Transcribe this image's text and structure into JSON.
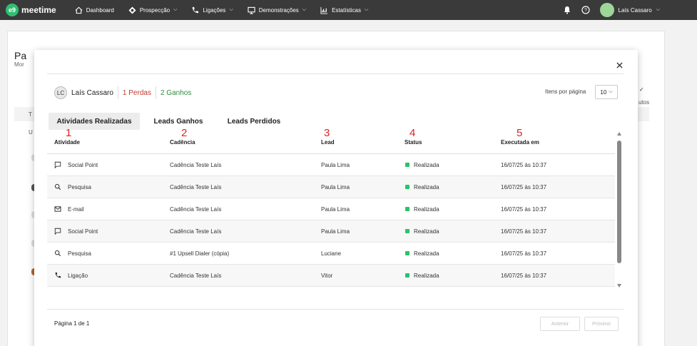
{
  "topbar": {
    "logo_mark": "e9",
    "logo_text": "meetime",
    "nav": [
      {
        "label": "Dashboard",
        "icon": "home-icon"
      },
      {
        "label": "Prospecção",
        "icon": "target-icon"
      },
      {
        "label": "Ligações",
        "icon": "phone-icon"
      },
      {
        "label": "Demonstrações",
        "icon": "monitor-icon"
      },
      {
        "label": "Estatísticas",
        "icon": "chart-icon"
      }
    ],
    "user_name": "Laís Cassaro",
    "bell_icon": "bell-icon",
    "help_icon": "help-icon"
  },
  "background": {
    "title_fragment": "Pa",
    "subtitle_fragment": "Mor",
    "col_fragment": "T",
    "row_fragment": "U",
    "right_fragment": "utos"
  },
  "modal": {
    "user_initials": "LC",
    "user_name": "Laís Cassaro",
    "losses": "1 Perdas",
    "gains": "2 Ganhos",
    "per_page_label": "Itens por página",
    "per_page_value": "10",
    "tabs": [
      "Atividades Realizadas",
      "Leads Ganhos",
      "Leads Perdidos"
    ],
    "column_numbers": [
      "1",
      "2",
      "3",
      "4",
      "5"
    ],
    "columns": [
      "Atividade",
      "Cadência",
      "Lead",
      "Status",
      "Executada em"
    ],
    "rows": [
      {
        "icon": "chat-icon",
        "activity": "Social Point",
        "cadence": "Cadência Teste Laís",
        "lead": "Paula Lima",
        "status": "Realizada",
        "executed": "16/07/25 às 10:37"
      },
      {
        "icon": "search-icon",
        "activity": "Pesquisa",
        "cadence": "Cadência Teste Laís",
        "lead": "Paula Lima",
        "status": "Realizada",
        "executed": "16/07/25 às 10:37"
      },
      {
        "icon": "email-icon",
        "activity": "E-mail",
        "cadence": "Cadência Teste Laís",
        "lead": "Paula Lima",
        "status": "Realizada",
        "executed": "16/07/25 às 10:37"
      },
      {
        "icon": "chat-icon",
        "activity": "Social Point",
        "cadence": "Cadência Teste Laís",
        "lead": "Paula Lima",
        "status": "Realizada",
        "executed": "16/07/25 às 10:37"
      },
      {
        "icon": "search-icon",
        "activity": "Pesquisa",
        "cadence": "#1 Upsell Dialer (cópia)",
        "lead": "Luciane",
        "status": "Realizada",
        "executed": "16/07/25 às 10:37"
      },
      {
        "icon": "phone-icon",
        "activity": "Ligação",
        "cadence": "Cadência Teste Laís",
        "lead": "Vitor",
        "status": "Realizada",
        "executed": "16/07/25 às 10:37"
      }
    ],
    "page_info": "Página 1 de 1",
    "prev_label": "Anterior",
    "next_label": "Próximo",
    "status_color": "#27c46a"
  }
}
